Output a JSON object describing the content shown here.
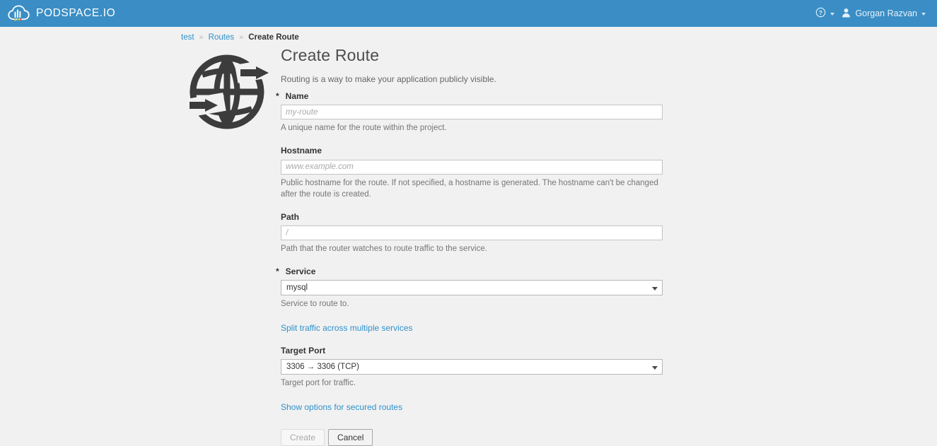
{
  "navbar": {
    "brand_text": "PODSPACE.IO",
    "brand_logo_icon": "cloud-logo-icon",
    "help": {
      "icon": "help-circle-icon",
      "caret_icon": "chevron-down-icon"
    },
    "user": {
      "icon": "user-icon",
      "name": "Gorgan Razvan",
      "caret_icon": "chevron-down-icon"
    }
  },
  "breadcrumb": {
    "items": [
      {
        "label": "test",
        "link": true
      },
      {
        "label": "Routes",
        "link": true
      },
      {
        "label": "Create Route",
        "link": false
      }
    ],
    "separator": "»"
  },
  "illustration": {
    "icon": "globe-routing-icon"
  },
  "form": {
    "title": "Create Route",
    "intro": "Routing is a way to make your application publicly visible.",
    "required_marker": "*",
    "fields": {
      "name": {
        "label": "Name",
        "required": true,
        "value": "",
        "placeholder": "my-route",
        "hint": "A unique name for the route within the project."
      },
      "hostname": {
        "label": "Hostname",
        "required": false,
        "value": "",
        "placeholder": "www.example.com",
        "hint": "Public hostname for the route. If not specified, a hostname is generated. The hostname can't be changed after the route is created."
      },
      "path": {
        "label": "Path",
        "required": false,
        "value": "",
        "placeholder": "/",
        "hint": "Path that the router watches to route traffic to the service."
      },
      "service": {
        "label": "Service",
        "required": true,
        "selected": "mysql",
        "options": [
          "mysql"
        ],
        "hint": "Service to route to."
      },
      "target_port": {
        "label": "Target Port",
        "required": false,
        "selected": "3306 → 3306 (TCP)",
        "options": [
          "3306 → 3306 (TCP)"
        ],
        "hint": "Target port for traffic."
      }
    },
    "links": {
      "split_traffic": "Split traffic across multiple services",
      "secured_routes": "Show options for secured routes"
    },
    "buttons": {
      "create": "Create",
      "cancel": "Cancel"
    }
  },
  "colors": {
    "navbar_blue": "#3a8ec5",
    "link_blue": "#2f91cc",
    "page_bg": "#f1f1f1",
    "text_dark": "#333333",
    "hint_gray": "#767676"
  }
}
